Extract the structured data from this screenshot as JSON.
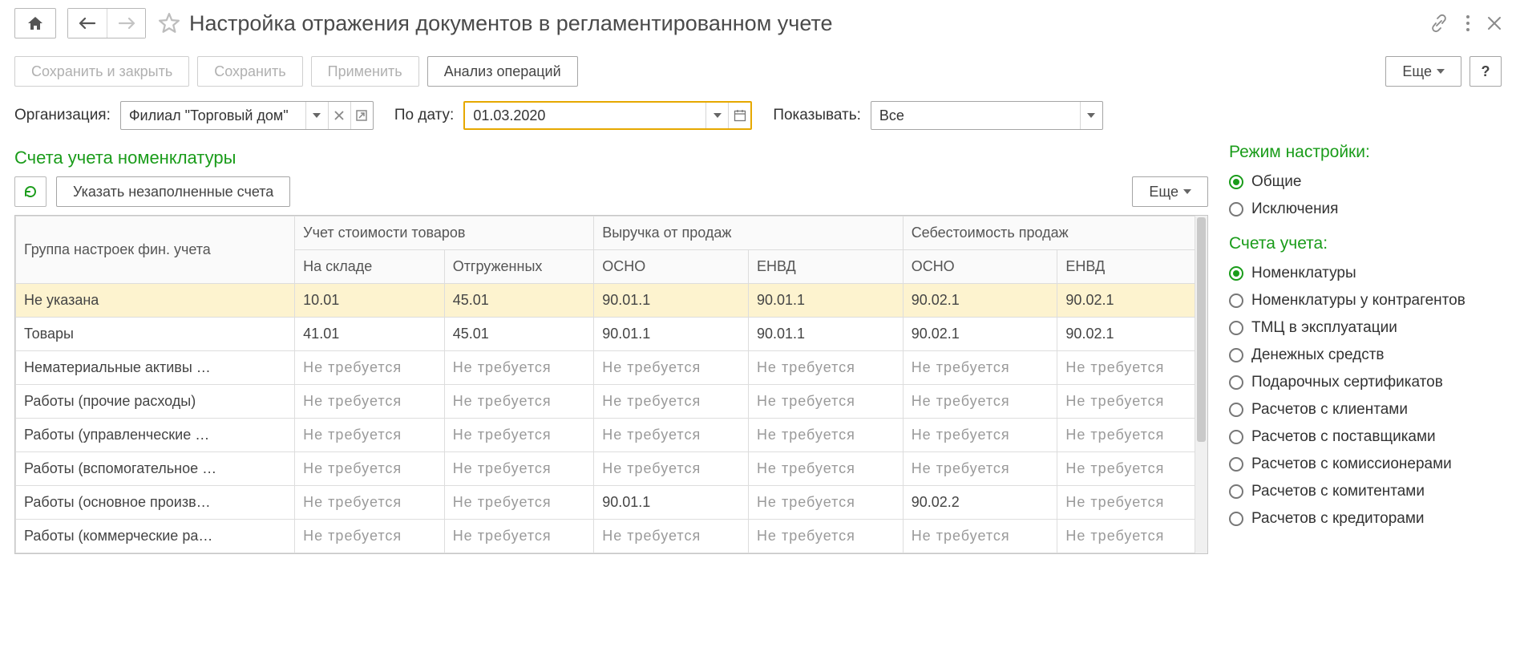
{
  "title": "Настройка отражения документов в регламентированном учете",
  "cmd": {
    "save_close": "Сохранить и закрыть",
    "save": "Сохранить",
    "apply": "Применить",
    "analyze": "Анализ операций",
    "more": "Еще",
    "help": "?"
  },
  "filter": {
    "org_label": "Организация:",
    "org_value": "Филиал \"Торговый дом\"",
    "date_label": "По дату:",
    "date_value": "01.03.2020",
    "show_label": "Показывать:",
    "show_value": "Все"
  },
  "section_title": "Счета учета номенклатуры",
  "table_toolbar": {
    "fill_unfilled": "Указать незаполненные счета",
    "more": "Еще"
  },
  "table": {
    "col_group": "Группа настроек фин. учета",
    "col_cost": "Учет стоимости товаров",
    "col_cost_stock": "На складе",
    "col_cost_shipped": "Отгруженных",
    "col_rev": "Выручка от продаж",
    "col_rev_osno": "ОСНО",
    "col_rev_envd": "ЕНВД",
    "col_cogs": "Себестоимость продаж",
    "col_cogs_osno": "ОСНО",
    "col_cogs_envd": "ЕНВД",
    "not_required": "Не требуется",
    "rows": [
      {
        "name": "Не указана",
        "stock": "10.01",
        "shipped": "45.01",
        "rev_o": "90.01.1",
        "rev_e": "90.01.1",
        "cogs_o": "90.02.1",
        "cogs_e": "90.02.1",
        "selected": true
      },
      {
        "name": "Товары",
        "stock": "41.01",
        "shipped": "45.01",
        "rev_o": "90.01.1",
        "rev_e": "90.01.1",
        "cogs_o": "90.02.1",
        "cogs_e": "90.02.1"
      },
      {
        "name": "Нематериальные активы …",
        "stock": null,
        "shipped": null,
        "rev_o": null,
        "rev_e": null,
        "cogs_o": null,
        "cogs_e": null
      },
      {
        "name": "Работы (прочие расходы)",
        "stock": null,
        "shipped": null,
        "rev_o": null,
        "rev_e": null,
        "cogs_o": null,
        "cogs_e": null
      },
      {
        "name": "Работы (управленческие …",
        "stock": null,
        "shipped": null,
        "rev_o": null,
        "rev_e": null,
        "cogs_o": null,
        "cogs_e": null
      },
      {
        "name": "Работы (вспомогательное …",
        "stock": null,
        "shipped": null,
        "rev_o": null,
        "rev_e": null,
        "cogs_o": null,
        "cogs_e": null
      },
      {
        "name": "Работы (основное произв…",
        "stock": null,
        "shipped": null,
        "rev_o": "90.01.1",
        "rev_e": null,
        "cogs_o": "90.02.2",
        "cogs_e": null
      },
      {
        "name": "Работы (коммерческие ра…",
        "stock": null,
        "shipped": null,
        "rev_o": null,
        "rev_e": null,
        "cogs_o": null,
        "cogs_e": null
      }
    ]
  },
  "right": {
    "mode_heading": "Режим настройки:",
    "mode_options": [
      {
        "label": "Общие",
        "checked": true
      },
      {
        "label": "Исключения",
        "checked": false
      }
    ],
    "accounts_heading": "Счета учета:",
    "account_options": [
      {
        "label": "Номенклатуры",
        "checked": true
      },
      {
        "label": "Номенклатуры у контрагентов",
        "checked": false
      },
      {
        "label": "ТМЦ в эксплуатации",
        "checked": false
      },
      {
        "label": "Денежных средств",
        "checked": false
      },
      {
        "label": "Подарочных сертификатов",
        "checked": false
      },
      {
        "label": "Расчетов с клиентами",
        "checked": false
      },
      {
        "label": "Расчетов с поставщиками",
        "checked": false
      },
      {
        "label": "Расчетов с комиссионерами",
        "checked": false
      },
      {
        "label": "Расчетов с комитентами",
        "checked": false
      },
      {
        "label": "Расчетов с кредиторами",
        "checked": false
      }
    ]
  }
}
